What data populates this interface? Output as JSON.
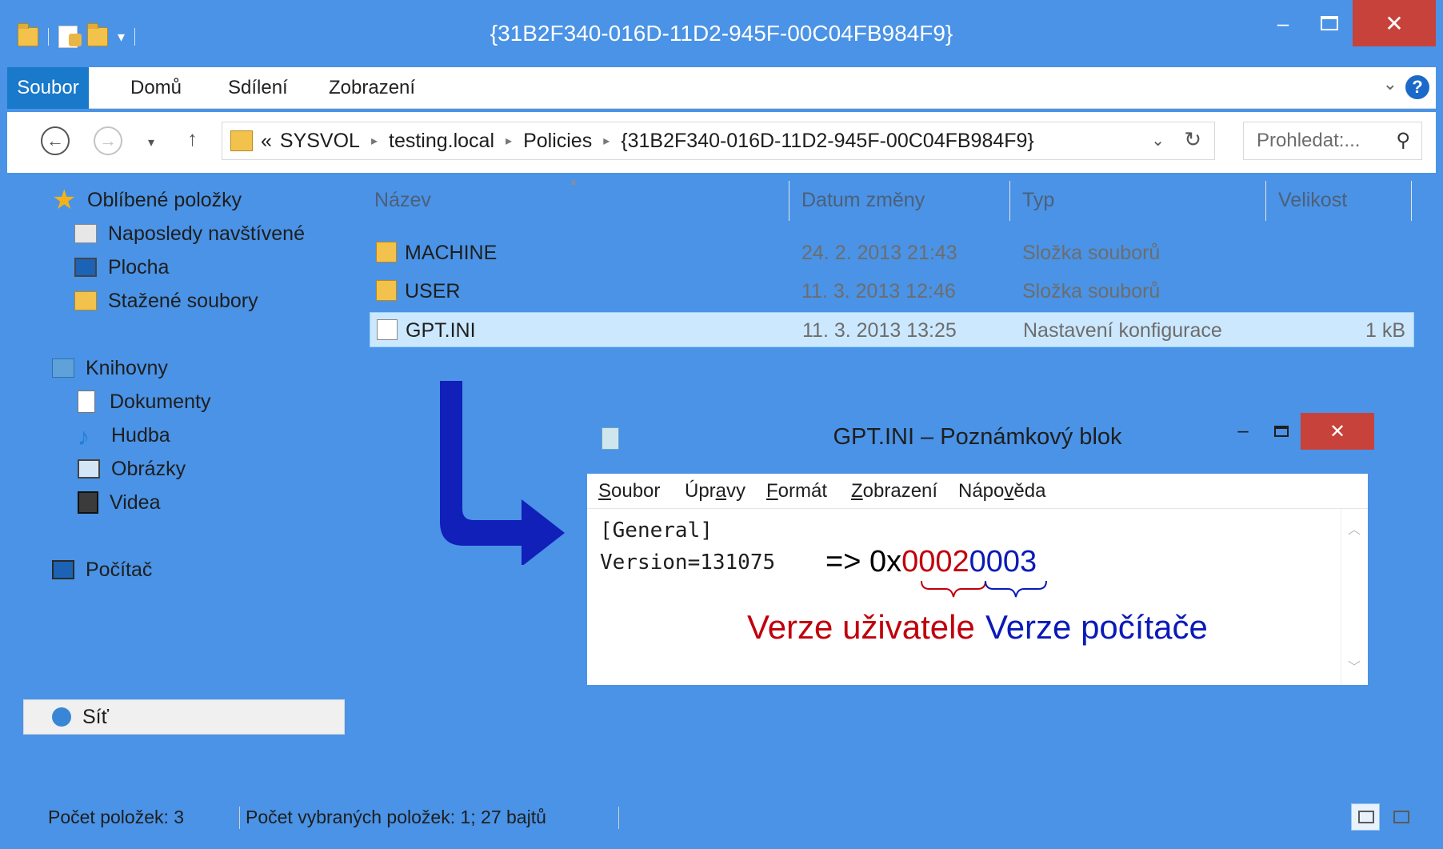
{
  "window": {
    "title": "{31B2F340-016D-11D2-945F-00C04FB984F9}",
    "minimize_glyph": "–",
    "close_glyph": "✕"
  },
  "ribbon": {
    "tabs": [
      "Soubor",
      "Domů",
      "Sdílení",
      "Zobrazení"
    ],
    "help_glyph": "?"
  },
  "address": {
    "back_glyph": "←",
    "forward_glyph": "→",
    "recent_glyph": "▾",
    "up_glyph": "↑",
    "overflow": "«",
    "crumbs": [
      "SYSVOL",
      "testing.local",
      "Policies",
      "{31B2F340-016D-11D2-945F-00C04FB984F9}"
    ],
    "crumb_separator": "▸",
    "dropdown_glyph": "⌄",
    "refresh_glyph": "↻",
    "search_placeholder": "Prohledat:...",
    "search_glyph": "⚲"
  },
  "nav": {
    "favorites": {
      "label": "Oblíbené položky",
      "items": [
        "Naposledy navštívené",
        "Plocha",
        "Stažené soubory"
      ]
    },
    "libraries": {
      "label": "Knihovny",
      "items": [
        "Dokumenty",
        "Hudba",
        "Obrázky",
        "Videa"
      ]
    },
    "computer": "Počítač",
    "network": "Síť"
  },
  "file_list": {
    "columns": [
      "Název",
      "Datum změny",
      "Typ",
      "Velikost"
    ],
    "rows": [
      {
        "name": "MACHINE",
        "date": "24. 2. 2013 21:43",
        "type": "Složka souborů",
        "size": "",
        "icon": "folder-icon"
      },
      {
        "name": "USER",
        "date": "11. 3. 2013 12:46",
        "type": "Složka souborů",
        "size": "",
        "icon": "folder-icon"
      },
      {
        "name": "GPT.INI",
        "date": "11. 3. 2013 13:25",
        "type": "Nastavení konfigurace",
        "size": "1 kB",
        "icon": "ini-file-icon"
      }
    ],
    "selected_row": 2
  },
  "status_bar": {
    "item_count": "Počet položek: 3",
    "selection": "Počet vybraných položek: 1; 27 bajtů"
  },
  "notepad": {
    "title": "GPT.INI – Poznámkový blok",
    "menu": [
      {
        "pre": "",
        "key": "S",
        "post": "oubor"
      },
      {
        "pre": "Úpr",
        "key": "a",
        "post": "vy"
      },
      {
        "pre": "",
        "key": "F",
        "post": "ormát"
      },
      {
        "pre": "",
        "key": "Z",
        "post": "obrazení"
      },
      {
        "pre": "Nápo",
        "key": "v",
        "post": "ěda"
      }
    ],
    "lines": [
      "[General]",
      "Version=131075"
    ],
    "annotation": {
      "arrow": "=>",
      "hex_prefix": "0x",
      "user_part": "0002",
      "computer_part": "0003",
      "user_label": "Verze uživatele",
      "computer_label": "Verze počítače"
    }
  },
  "colors": {
    "titlebar": "#4a93e6",
    "file_tab": "#1979ca",
    "close_button": "#c7423a",
    "selection": "#cce8ff",
    "annotation_red": "#c0000c",
    "annotation_blue": "#0a1ab8",
    "overlay_arrow": "#1020b8"
  }
}
